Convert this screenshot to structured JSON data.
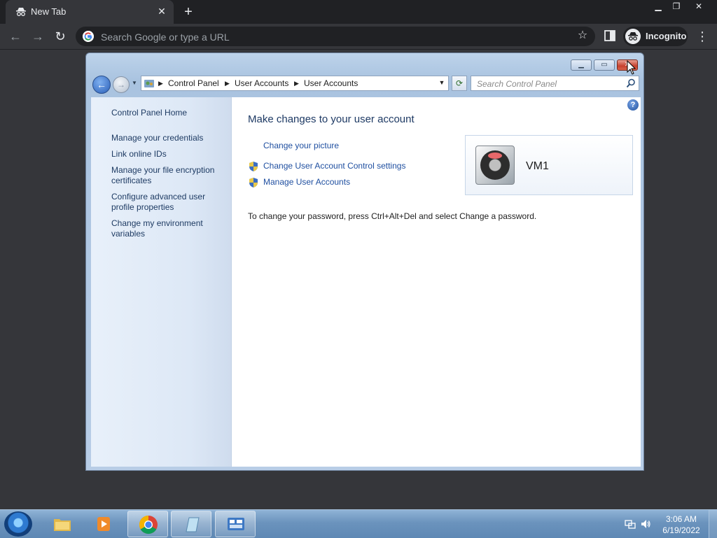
{
  "browser": {
    "tab_title": "New Tab",
    "omnibox_placeholder": "Search Google or type a URL",
    "incognito_label": "Incognito"
  },
  "window": {
    "breadcrumb": [
      "Control Panel",
      "User Accounts",
      "User Accounts"
    ],
    "search_placeholder": "Search Control Panel",
    "left_links": [
      "Control Panel Home",
      "Manage your credentials",
      "Link online IDs",
      "Manage your file encryption certificates",
      "Configure advanced user profile properties",
      "Change my environment variables"
    ],
    "title": "Make changes to your user account",
    "tasks": [
      "Change your picture",
      "Change User Account Control settings",
      "Manage User Accounts"
    ],
    "note": "To change your password, press Ctrl+Alt+Del and select Change a password.",
    "user_name": "VM1"
  },
  "taskbar": {
    "time": "3:06 AM",
    "date": "6/19/2022"
  },
  "colors": {
    "link": "#1f4fa0",
    "title": "#1e3a64",
    "close_button": "#c7412e"
  }
}
